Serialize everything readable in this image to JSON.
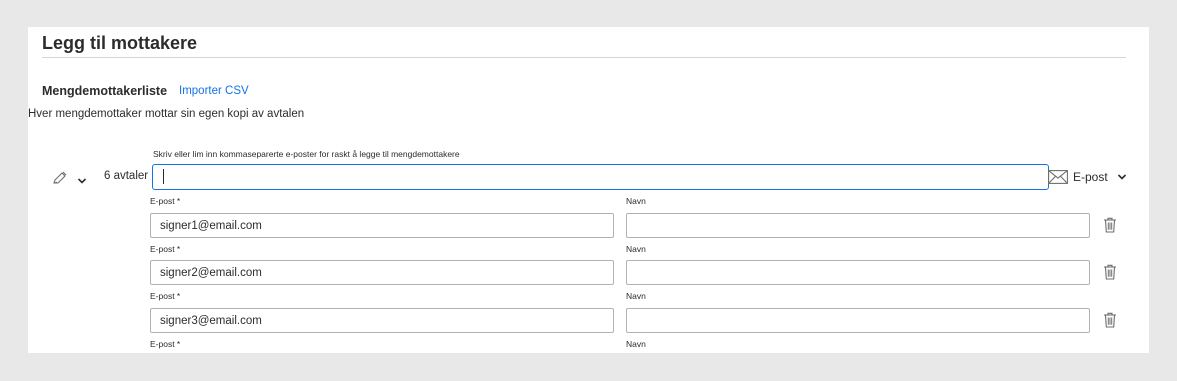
{
  "page": {
    "title": "Legg til mottakere"
  },
  "bulk": {
    "heading": "Mengdemottakerliste",
    "import_link": "Importer CSV",
    "description": "Hver mengdemottaker mottar sin egen kopi av avtalen",
    "hint": "Skriv eller lim inn kommaseparerte e-poster for raskt å legge til mengdemottakere",
    "count": "6 avtaler",
    "input_value": "",
    "delivery_method": "E-post",
    "role_icon": "pen-icon",
    "delivery_icon": "envelope-icon"
  },
  "recipients": [
    {
      "email_label": "E-post *",
      "name_label": "Navn",
      "email": "signer1@email.com",
      "name": ""
    },
    {
      "email_label": "E-post *",
      "name_label": "Navn",
      "email": "signer2@email.com",
      "name": ""
    },
    {
      "email_label": "E-post *",
      "name_label": "Navn",
      "email": "signer3@email.com",
      "name": ""
    },
    {
      "email_label": "E-post *",
      "name_label": "Navn"
    }
  ],
  "colors": {
    "accent": "#1473e6",
    "page_background": "#e8e8e8",
    "panel_background": "#ffffff",
    "field_border": "#b3b3b3"
  }
}
